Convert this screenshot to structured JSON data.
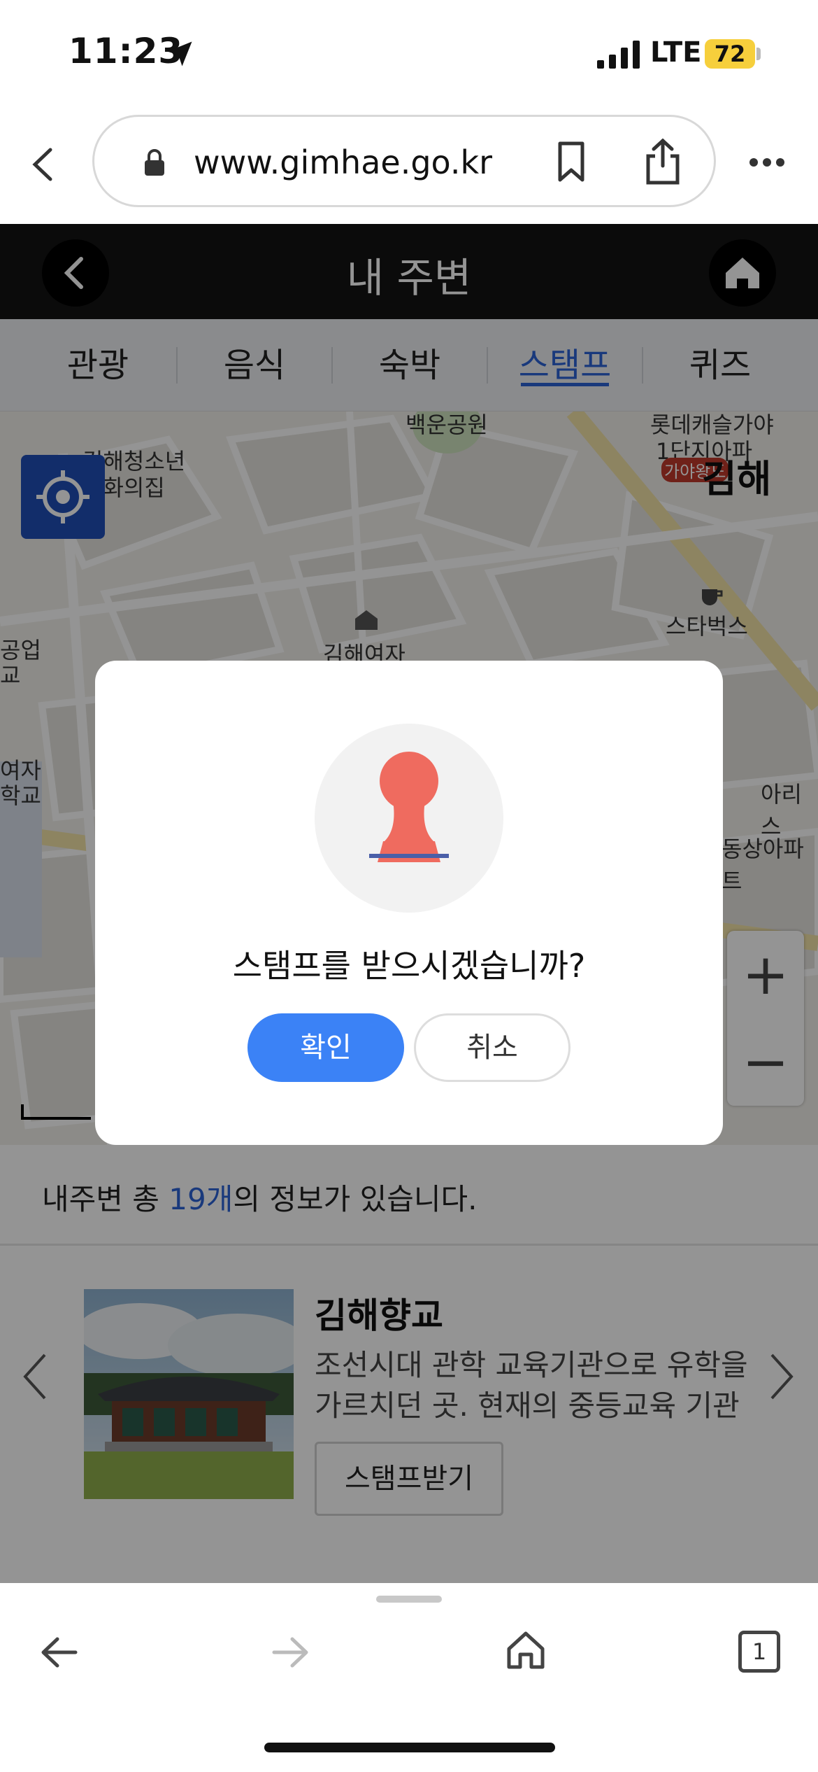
{
  "status_bar": {
    "time": "11:23",
    "network": "LTE",
    "battery": "72"
  },
  "browser": {
    "url": "www.gimhae.go.kr",
    "tab_count": "1"
  },
  "header": {
    "title": "내 주변"
  },
  "tabs": [
    {
      "label": "관광",
      "active": false
    },
    {
      "label": "음식",
      "active": false
    },
    {
      "label": "숙박",
      "active": false
    },
    {
      "label": "스탬프",
      "active": true
    },
    {
      "label": "퀴즈",
      "active": false
    }
  ],
  "map": {
    "labels": {
      "youth_center": "김해청소년",
      "culture_house": "문화의집",
      "baekun_park": "백운공원",
      "lotte_castle_1": "롯데캐슬가야",
      "lotte_castle_2": "1단지아파",
      "brand": "김해",
      "brand_badge": "가야왕도",
      "starbucks": "스타벅스",
      "girls_school": "김해여자",
      "industrial_1": "공업",
      "industrial_2": "교",
      "women_1": "여자",
      "women_2": "학교",
      "aris": "아리스",
      "dongsang_apt": "동상아파트"
    },
    "zoom_in": "+",
    "zoom_out": "−"
  },
  "info": {
    "prefix": "내주변 총 ",
    "count": "19개",
    "suffix": "의 정보가 있습니다."
  },
  "card": {
    "title": "김해향교",
    "description": "조선시대 관학 교육기관으로 유학을 가르치던 곳. 현재의 중등교육 기관",
    "button": "스탬프받기"
  },
  "dialog": {
    "message": "스탬프를 받으시겠습니까?",
    "confirm": "확인",
    "cancel": "취소"
  },
  "colors": {
    "accent": "#3b82f6",
    "tab_active": "#2b63d6",
    "stamp": "#ef6b5f",
    "header_bg": "#141414"
  }
}
